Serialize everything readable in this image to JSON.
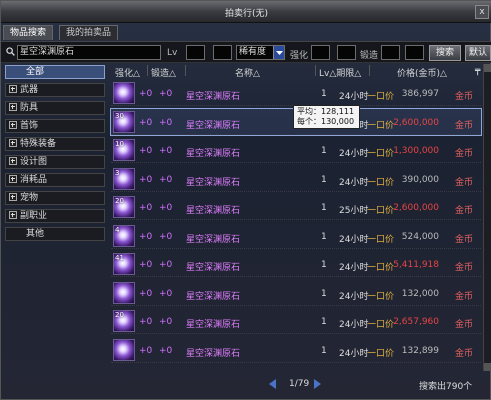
{
  "window": {
    "title": "拍卖行(无)",
    "close": "x"
  },
  "tabs": [
    {
      "label": "物品搜索"
    },
    {
      "label": "我的拍卖品"
    }
  ],
  "search": {
    "query": "星空深渊原石",
    "lv_label": "Lv",
    "lv_min": "",
    "lv_max": "",
    "rarity_value": "稀有度",
    "enhance_label": "强化",
    "enhance_min": "",
    "enhance_max": "",
    "refine_label": "锻造",
    "refine_min": "",
    "refine_max": "",
    "search_button": "搜索",
    "default_button": "默认"
  },
  "sidebar": {
    "items": [
      {
        "label": "全部",
        "selected": true,
        "expandable": false
      },
      {
        "label": "武器",
        "expandable": true
      },
      {
        "label": "防具",
        "expandable": true
      },
      {
        "label": "首饰",
        "expandable": true
      },
      {
        "label": "特殊装备",
        "expandable": true
      },
      {
        "label": "设计图",
        "expandable": true
      },
      {
        "label": "消耗品",
        "expandable": true
      },
      {
        "label": "宠物",
        "expandable": true
      },
      {
        "label": "副职业",
        "expandable": true
      },
      {
        "label": "其他",
        "expandable": false
      }
    ]
  },
  "columns": {
    "enhance": "强化△",
    "refine": "锻造△",
    "name": "名称△",
    "lv_term": "Lv△期限△",
    "price": "价格(金币)△"
  },
  "rows": [
    {
      "badge": "",
      "enhance": "+0",
      "refine": "+0",
      "name": "星空深渊原石",
      "lv": "1",
      "duration": "24小时",
      "buy": "一口价",
      "price": "386,997",
      "price_color": "normal",
      "currency": "金币"
    },
    {
      "badge": "30",
      "enhance": "+0",
      "refine": "+0",
      "name": "星空深渊原石",
      "lv": "1",
      "duration": "24小时",
      "buy": "一口价",
      "price": "2,600,000",
      "price_color": "red",
      "currency": "金币",
      "highlighted": true
    },
    {
      "badge": "10",
      "enhance": "+0",
      "refine": "+0",
      "name": "星空深渊原石",
      "lv": "1",
      "duration": "24小时",
      "buy": "一口价",
      "price": "1,300,000",
      "price_color": "red",
      "currency": "金币"
    },
    {
      "badge": "3",
      "enhance": "+0",
      "refine": "+0",
      "name": "星空深渊原石",
      "lv": "1",
      "duration": "24小时",
      "buy": "一口价",
      "price": "390,000",
      "price_color": "normal",
      "currency": "金币"
    },
    {
      "badge": "20",
      "enhance": "+0",
      "refine": "+0",
      "name": "星空深渊原石",
      "lv": "1",
      "duration": "25小时",
      "buy": "一口价",
      "price": "2,600,000",
      "price_color": "red",
      "currency": "金币"
    },
    {
      "badge": "4",
      "enhance": "+0",
      "refine": "+0",
      "name": "星空深渊原石",
      "lv": "1",
      "duration": "24小时",
      "buy": "一口价",
      "price": "524,000",
      "price_color": "normal",
      "currency": "金币"
    },
    {
      "badge": "41",
      "enhance": "+0",
      "refine": "+0",
      "name": "星空深渊原石",
      "lv": "1",
      "duration": "24小时",
      "buy": "一口价",
      "price": "5,411,918",
      "price_color": "red",
      "currency": "金币"
    },
    {
      "badge": "",
      "enhance": "+0",
      "refine": "+0",
      "name": "星空深渊原石",
      "lv": "1",
      "duration": "24小时",
      "buy": "一口价",
      "price": "132,000",
      "price_color": "normal",
      "currency": "金币"
    },
    {
      "badge": "20",
      "enhance": "+0",
      "refine": "+0",
      "name": "星空深渊原石",
      "lv": "1",
      "duration": "24小时",
      "buy": "一口价",
      "price": "2,657,960",
      "price_color": "red",
      "currency": "金币"
    },
    {
      "badge": "",
      "enhance": "+0",
      "refine": "+0",
      "name": "星空深渊原石",
      "lv": "1",
      "duration": "24小时",
      "buy": "一口价",
      "price": "132,899",
      "price_color": "normal",
      "currency": "金币"
    }
  ],
  "tooltip": {
    "line1": "平均：128,111",
    "line2": "每个：130,000"
  },
  "pagination": {
    "page": "1/79",
    "results": "搜索出790个"
  },
  "colors": {
    "price_red": "#e64545",
    "item_name": "#e07fff",
    "buy_gold": "#e0b040",
    "selected": "#3a4e7a"
  }
}
